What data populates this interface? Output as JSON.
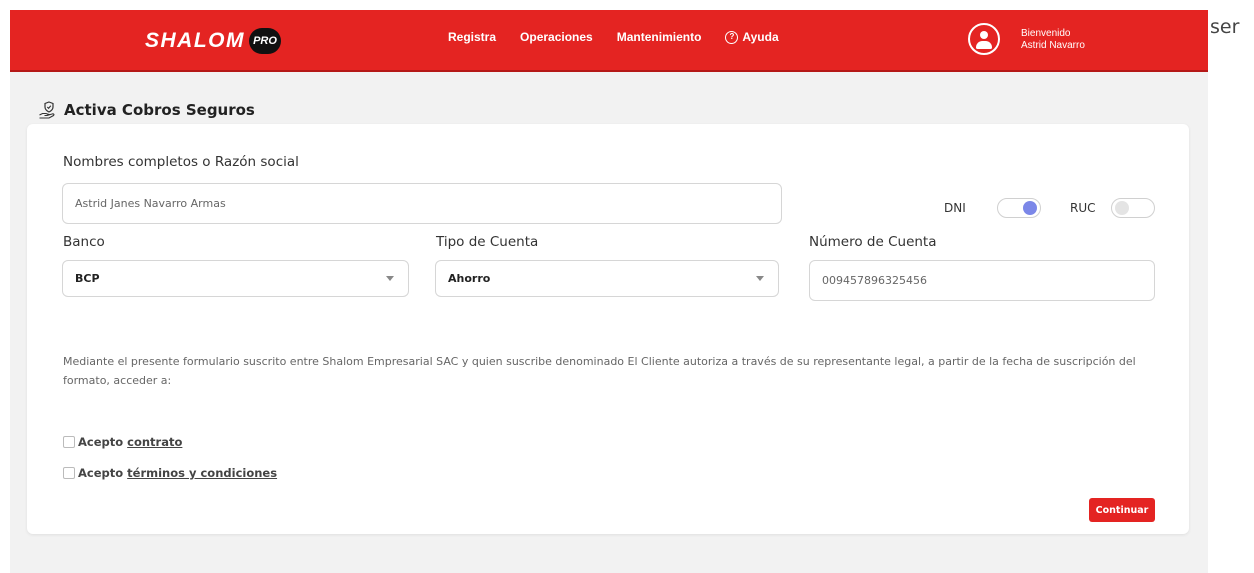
{
  "header": {
    "logo_text": "SHALOM",
    "logo_badge": "PRO",
    "nav": [
      {
        "label": "Registra"
      },
      {
        "label": "Operaciones"
      },
      {
        "label": "Mantenimiento"
      },
      {
        "label": "Ayuda",
        "icon": "question-circle-icon"
      }
    ],
    "user": {
      "greeting": "Bienvenido",
      "name": "Astrid Navarro"
    },
    "accent_color": "#e42422"
  },
  "outside_fragment": "ser",
  "page": {
    "title": "Activa Cobros Seguros",
    "title_icon": "hand-shield-icon"
  },
  "form": {
    "name_label": "Nombres completos o Razón social",
    "name_value": "Astrid Janes Navarro Armas",
    "doc_type": {
      "dni_label": "DNI",
      "dni_on": true,
      "ruc_label": "RUC",
      "ruc_on": false
    },
    "bank_label": "Banco",
    "bank_value": "BCP",
    "account_type_label": "Tipo de Cuenta",
    "account_type_value": "Ahorro",
    "account_number_label": "Número de Cuenta",
    "account_number_value": "009457896325456",
    "disclaimer": "Mediante el presente formulario suscrito entre Shalom Empresarial SAC y quien suscribe denominado El Cliente autoriza a través de su representante legal, a partir de la fecha de suscripción del formato, acceder a:",
    "accept_prefix": "Acepto",
    "contract_link": "contrato",
    "terms_link": "términos y condiciones",
    "continue_label": "Continuar"
  }
}
